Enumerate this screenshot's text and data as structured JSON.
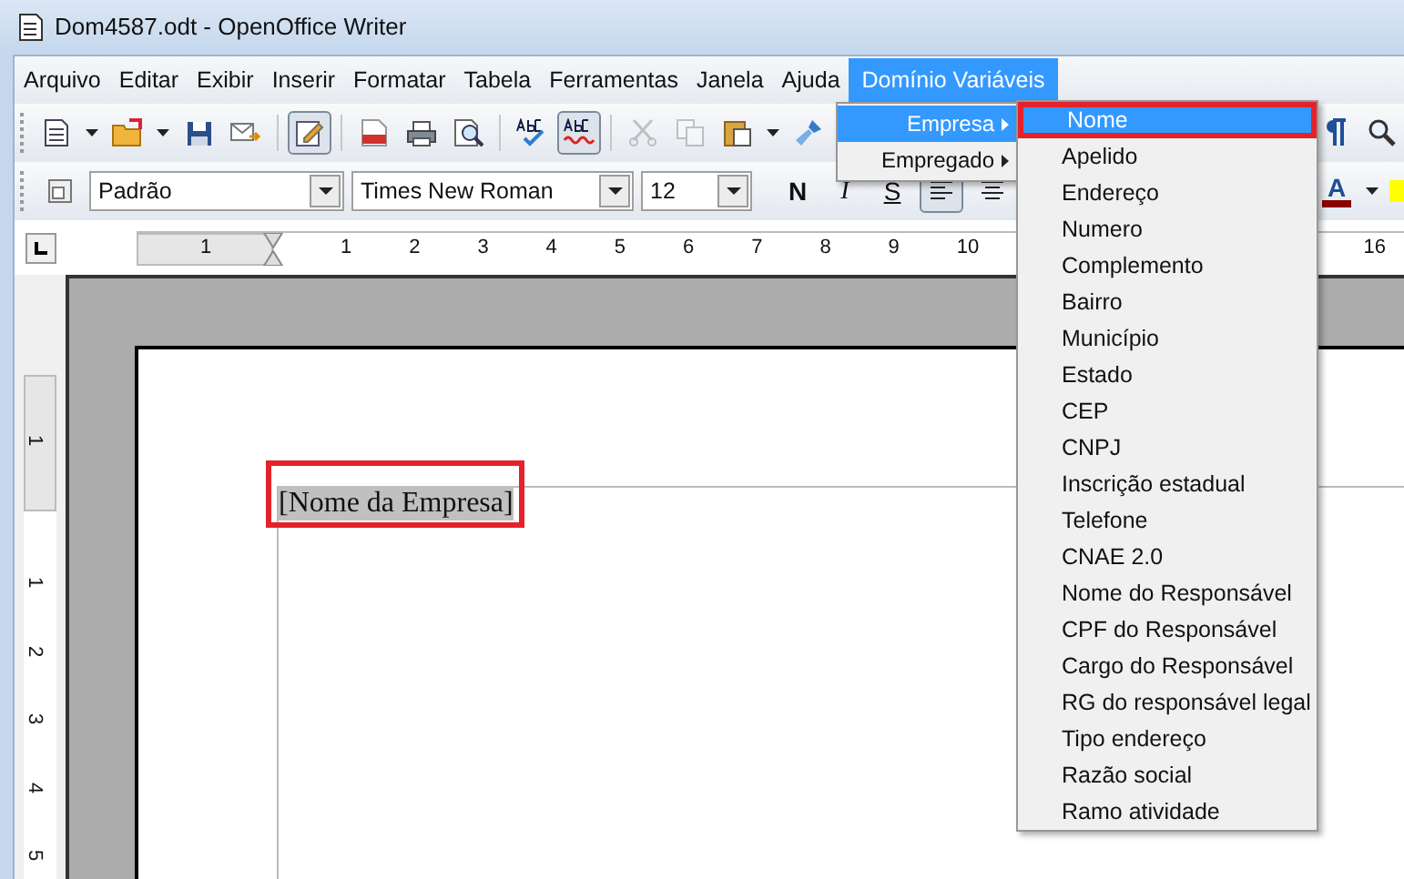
{
  "window": {
    "title": "Dom4587.odt - OpenOffice Writer"
  },
  "menu_bar": [
    {
      "label": "Arquivo",
      "selected": false
    },
    {
      "label": "Editar",
      "selected": false
    },
    {
      "label": "Exibir",
      "selected": false
    },
    {
      "label": "Inserir",
      "selected": false
    },
    {
      "label": "Formatar",
      "selected": false
    },
    {
      "label": "Tabela",
      "selected": false
    },
    {
      "label": "Ferramentas",
      "selected": false
    },
    {
      "label": "Janela",
      "selected": false
    },
    {
      "label": "Ajuda",
      "selected": false
    },
    {
      "label": "Domínio Variáveis",
      "selected": true
    }
  ],
  "submenu": [
    {
      "label": "Empresa",
      "selected": true
    },
    {
      "label": "Empregado",
      "selected": false
    }
  ],
  "empresa_menu": [
    {
      "label": "Nome",
      "selected": true,
      "annotated": true
    },
    {
      "label": "Apelido",
      "selected": false,
      "annotated": false
    },
    {
      "label": "Endereço",
      "selected": false,
      "annotated": false
    },
    {
      "label": "Numero",
      "selected": false,
      "annotated": false
    },
    {
      "label": "Complemento",
      "selected": false,
      "annotated": false
    },
    {
      "label": "Bairro",
      "selected": false,
      "annotated": false
    },
    {
      "label": "Município",
      "selected": false,
      "annotated": false
    },
    {
      "label": "Estado",
      "selected": false,
      "annotated": false
    },
    {
      "label": "CEP",
      "selected": false,
      "annotated": false
    },
    {
      "label": "CNPJ",
      "selected": false,
      "annotated": false
    },
    {
      "label": "Inscrição estadual",
      "selected": false,
      "annotated": false
    },
    {
      "label": "Telefone",
      "selected": false,
      "annotated": false
    },
    {
      "label": "CNAE 2.0",
      "selected": false,
      "annotated": false
    },
    {
      "label": "Nome do Responsável",
      "selected": false,
      "annotated": false
    },
    {
      "label": "CPF do Responsável",
      "selected": false,
      "annotated": false
    },
    {
      "label": "Cargo do Responsável",
      "selected": false,
      "annotated": false
    },
    {
      "label": "RG do responsável legal",
      "selected": false,
      "annotated": false
    },
    {
      "label": "Tipo endereço",
      "selected": false,
      "annotated": false
    },
    {
      "label": "Razão social",
      "selected": false,
      "annotated": false
    },
    {
      "label": "Ramo atividade",
      "selected": false,
      "annotated": false
    }
  ],
  "toolbar": {
    "edit_mode_pressed": true,
    "autospell_pressed": true,
    "cut_disabled": true,
    "copy_disabled": true
  },
  "format_bar": {
    "style": "Padrão",
    "font": "Times New Roman",
    "size": "12",
    "bold": "N",
    "italic": "I",
    "underline": "S",
    "align_left_pressed": true,
    "font_color": "A"
  },
  "ruler": {
    "labels": [
      "1",
      "1",
      "2",
      "3",
      "4",
      "5",
      "6",
      "7",
      "8",
      "9",
      "10"
    ],
    "right_label": "16"
  },
  "vertical_ruler": {
    "labels": [
      "1",
      "1",
      "2",
      "3",
      "4",
      "5"
    ]
  },
  "document": {
    "text": "[Nome da Empresa]",
    "annotated": true
  }
}
